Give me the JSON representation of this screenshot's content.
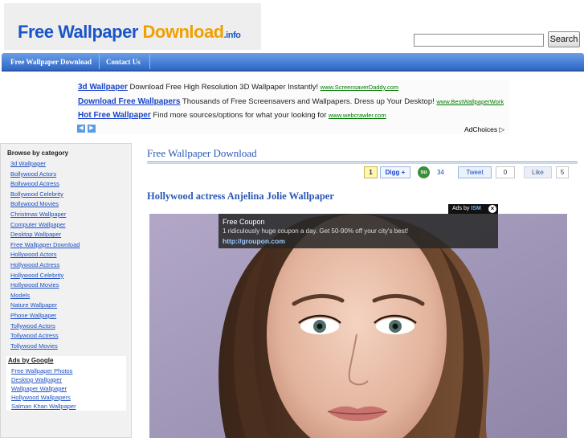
{
  "header": {
    "logo": {
      "part1": "Free Wallpaper ",
      "part2": "Download",
      "part3": ".info"
    },
    "search": {
      "value": "",
      "placeholder": "",
      "button_label": "Search"
    }
  },
  "nav": {
    "items": [
      {
        "label": "Free Wallpaper Download"
      },
      {
        "label": "Contact Us"
      }
    ]
  },
  "top_ads": {
    "rows": [
      {
        "title": "3d Wallpaper",
        "text": " Download Free High Resolution 3D Wallpaper Instantly! ",
        "url": "www.ScreensaverDaddy.com"
      },
      {
        "title": "Download Free Wallpapers",
        "text": " Thousands of Free Screensavers and Wallpapers. Dress up Your Desktop! ",
        "url": "www.BestWallpaperWork"
      },
      {
        "title": "Hot Free Wallpaper",
        "text": " Find more sources/options for what your looking for ",
        "url": "www.webcrawler.com"
      }
    ],
    "adchoices": "AdChoices ▷",
    "prev_arrow": "◀",
    "next_arrow": "▶"
  },
  "sidebar": {
    "title": "Browse by category",
    "categories": [
      "3d Wallpaper",
      "Bollywood Actors",
      "Bollywood Actress",
      "Bollywood Celebrity",
      "Bollywood Movies",
      "Christmas Wallpaper",
      "Computer Wallpaper",
      "Desktop Wallpaper",
      "Free Wallpaper Download",
      "Hollywood Actors",
      "Hollywood Actress",
      "Hollywood Celebrity",
      "Hollywood Movies",
      "Models",
      "Nature Wallpaper",
      "Phone Wallpaper",
      "Tollywood Actors",
      "Tollywood Actress",
      "Tollywood Movies"
    ],
    "google_ads": {
      "title": "Ads by Google",
      "links": [
        "Free Wallpaper Photos",
        "Desktop Wallpaper",
        "Wallpaper Wallpaper",
        "Hollywood Wallpapers",
        "Salman Khan Wallpaper"
      ]
    }
  },
  "main": {
    "section_title": "Free Wallpaper Download",
    "share": {
      "digg_count": "1",
      "digg_label": "Digg +",
      "stumble_icon": "su",
      "stumble_count": "34",
      "tweet_label": "Tweet",
      "tweet_count": "0",
      "like_label": "Like",
      "like_count": "5"
    },
    "post_title": "Hollywood actress Anjelina Jolie Wallpaper",
    "overlay_ad": {
      "tag_prefix": "Ads by ",
      "tag_brand": "ISM",
      "close": "×",
      "title": "Free Coupon",
      "text": "1 ridiculously huge coupon a day. Get 50-90% off your city's best!",
      "url": "http://groupon.com"
    }
  },
  "colors": {
    "link_blue": "#1b4fc4",
    "nav_blue": "#2f67c6",
    "logo_orange": "#f0a000",
    "ad_url_green": "#007a00"
  }
}
